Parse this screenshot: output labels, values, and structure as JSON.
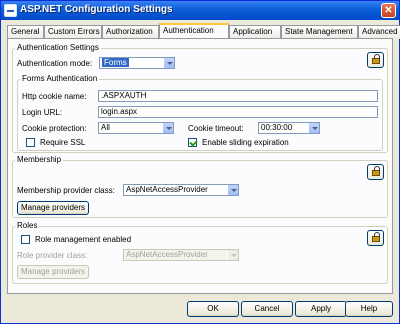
{
  "window": {
    "title": "ASP.NET Configuration Settings",
    "close_glyph": "✕"
  },
  "tabs": [
    {
      "label": "General"
    },
    {
      "label": "Custom Errors"
    },
    {
      "label": "Authorization"
    },
    {
      "label": "Authentication",
      "active": true
    },
    {
      "label": "Application"
    },
    {
      "label": "State Management"
    },
    {
      "label": "Advanced"
    }
  ],
  "auth_settings": {
    "label": "Authentication Settings",
    "mode_label": "Authentication mode:",
    "mode_value": "Forms",
    "forms": {
      "label": "Forms Authentication",
      "cookie_name_label": "Http cookie name:",
      "cookie_name_value": ".ASPXAUTH",
      "login_url_label": "Login URL:",
      "login_url_value": "login.aspx",
      "protection_label": "Cookie protection:",
      "protection_value": "All",
      "timeout_label": "Cookie timeout:",
      "timeout_value": "00:30:00",
      "require_ssl_label": "Require SSL",
      "require_ssl_checked": false,
      "sliding_label": "Enable sliding expiration",
      "sliding_checked": true
    }
  },
  "membership": {
    "label": "Membership",
    "provider_label": "Membership provider class:",
    "provider_value": "AspNetAccessProvider",
    "manage_label": "Manage providers"
  },
  "roles": {
    "label": "Roles",
    "enabled_label": "Role management enabled",
    "enabled_checked": false,
    "provider_label": "Role provider class:",
    "provider_value": "AspNetAccessProvider",
    "manage_label": "Manage providers"
  },
  "footer": {
    "ok": "OK",
    "cancel": "Cancel",
    "apply": "Apply",
    "help": "Help"
  }
}
